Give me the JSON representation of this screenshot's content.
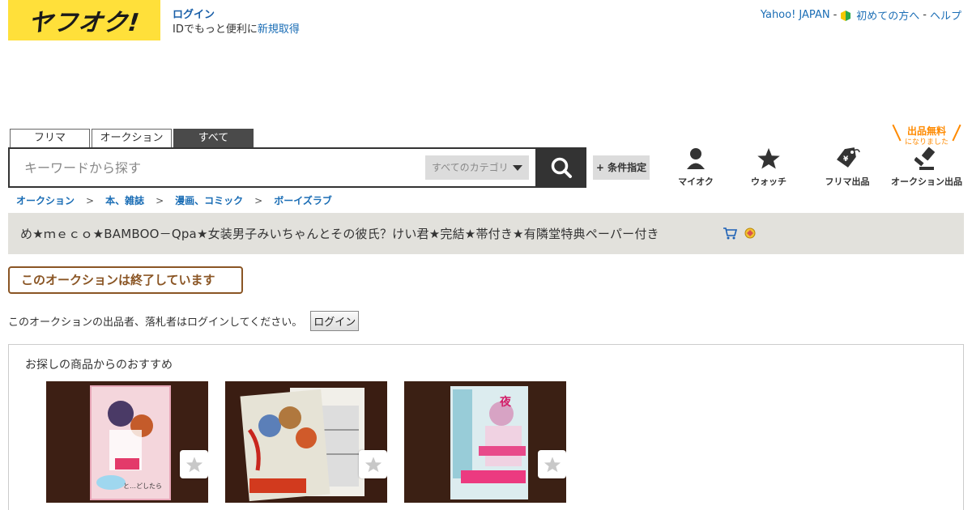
{
  "header": {
    "logo_text": "ヤフオク!",
    "login_label": "ログイン",
    "signup_prefix": "IDでもっと便利に",
    "signup_link": "新規取得",
    "links": [
      "Yahoo! JAPAN",
      "初めての方へ",
      "ヘルプ"
    ],
    "link_sep": "-"
  },
  "search": {
    "tabs": [
      "フリマ",
      "オークション",
      "すべて"
    ],
    "active_tab": "すべて",
    "placeholder": "キーワードから探す",
    "category": "すべてのカテゴリ",
    "condition_label": "+ 条件指定",
    "search_icon": "search-icon"
  },
  "nav": {
    "myauction": "マイオク",
    "watch": "ウォッチ",
    "flea_listing": "フリマ出品",
    "auction_listing": "オークション出品",
    "free_tag_big": "出品無料",
    "free_tag_small": "になりました",
    "accent_color": "#ff8a00"
  },
  "breadcrumb": [
    "オークション",
    "本、雑誌",
    "漫画、コミック",
    "ボーイズラブ"
  ],
  "breadcrumb_sep": ">",
  "item": {
    "title": "め★ｍｅｃｏ★BAMBOO－Qpa★女装男子みいちゃんとその彼氏？けい君★完結★帯付き★有隣堂特典ペーパー付き",
    "icons": [
      "cart-icon",
      "badge-icon"
    ]
  },
  "status": {
    "ended": "このオークションは終了しています",
    "ended_color": "#8a5524",
    "notice": "このオークションの出品者、落札者はログインしてください。",
    "login_button": "ログイン"
  },
  "recommend": {
    "title": "お探しの商品からのおすすめ",
    "items": [
      {
        "watch_icon": "star-icon"
      },
      {
        "watch_icon": "star-icon"
      },
      {
        "watch_icon": "star-icon"
      }
    ]
  }
}
